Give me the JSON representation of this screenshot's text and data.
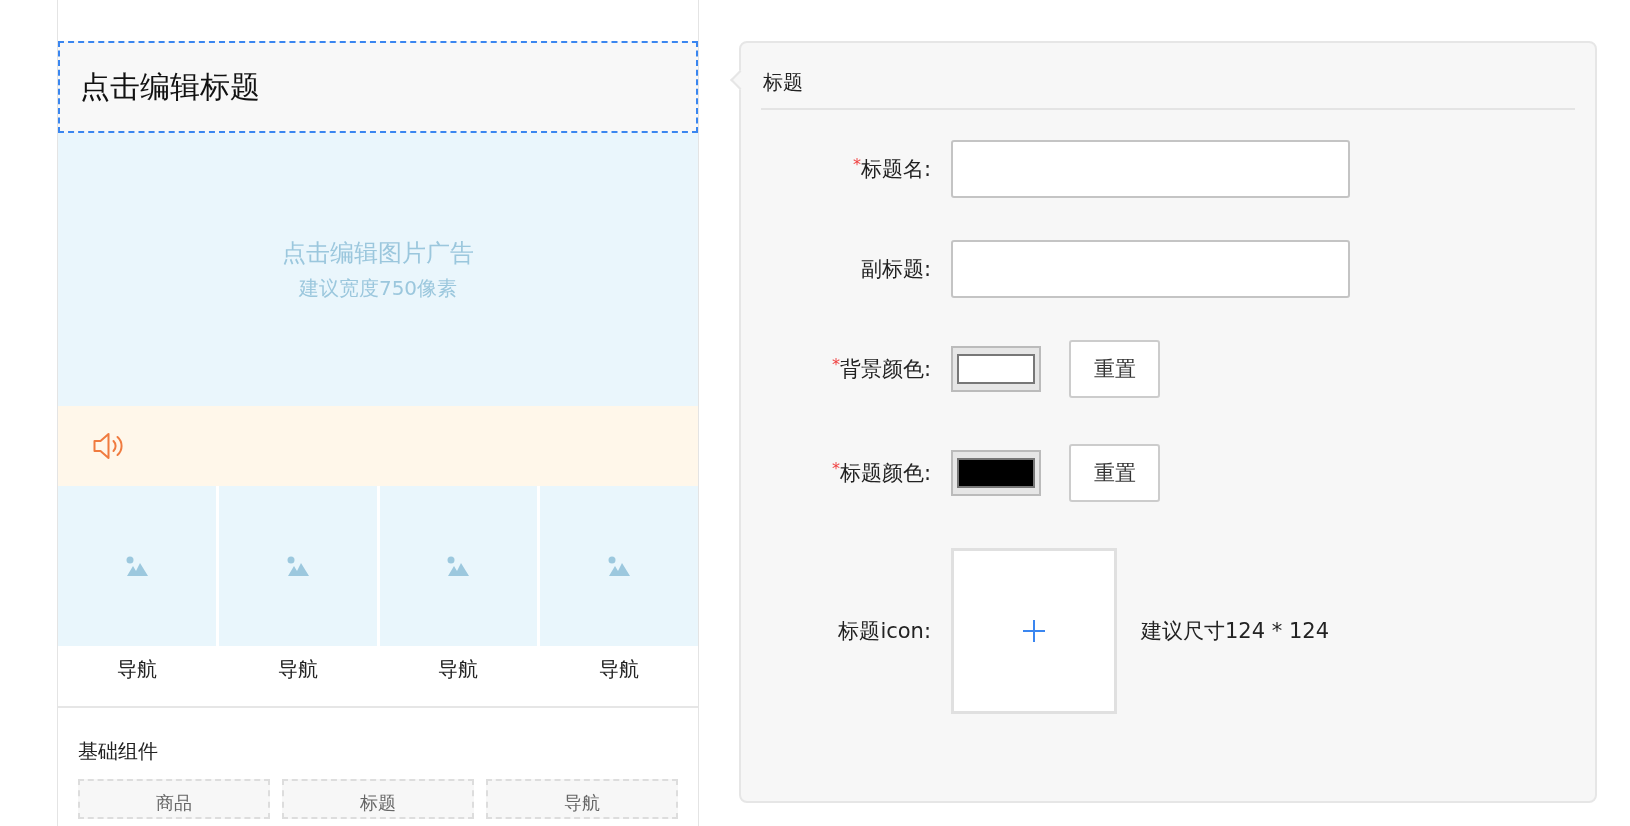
{
  "preview": {
    "title_block": {
      "text": "点击编辑标题",
      "selected": true
    },
    "image_ad": {
      "title": "点击编辑图片广告",
      "hint": "建议宽度750像素"
    },
    "notice": {
      "kind": "notice"
    },
    "nav_items": [
      {
        "label": "导航"
      },
      {
        "label": "导航"
      },
      {
        "label": "导航"
      },
      {
        "label": "导航"
      }
    ],
    "components": {
      "heading": "基础组件",
      "items": [
        "商品",
        "标题",
        "导航"
      ]
    }
  },
  "panel": {
    "title": "标题",
    "fields": [
      {
        "kind": "text",
        "label": "标题名:",
        "required_mark": "*"
      },
      {
        "kind": "text",
        "label": "副标题:"
      },
      {
        "kind": "color",
        "label": "背景颜色:",
        "required_mark": "*",
        "color": "#ffffff",
        "button": "重置"
      },
      {
        "kind": "color",
        "label": "标题颜色:",
        "required_mark": "*",
        "color": "#000000",
        "button": "重置"
      },
      {
        "kind": "upload",
        "label": "标题icon:",
        "hint": "建议尺寸124 * 124"
      }
    ]
  }
}
